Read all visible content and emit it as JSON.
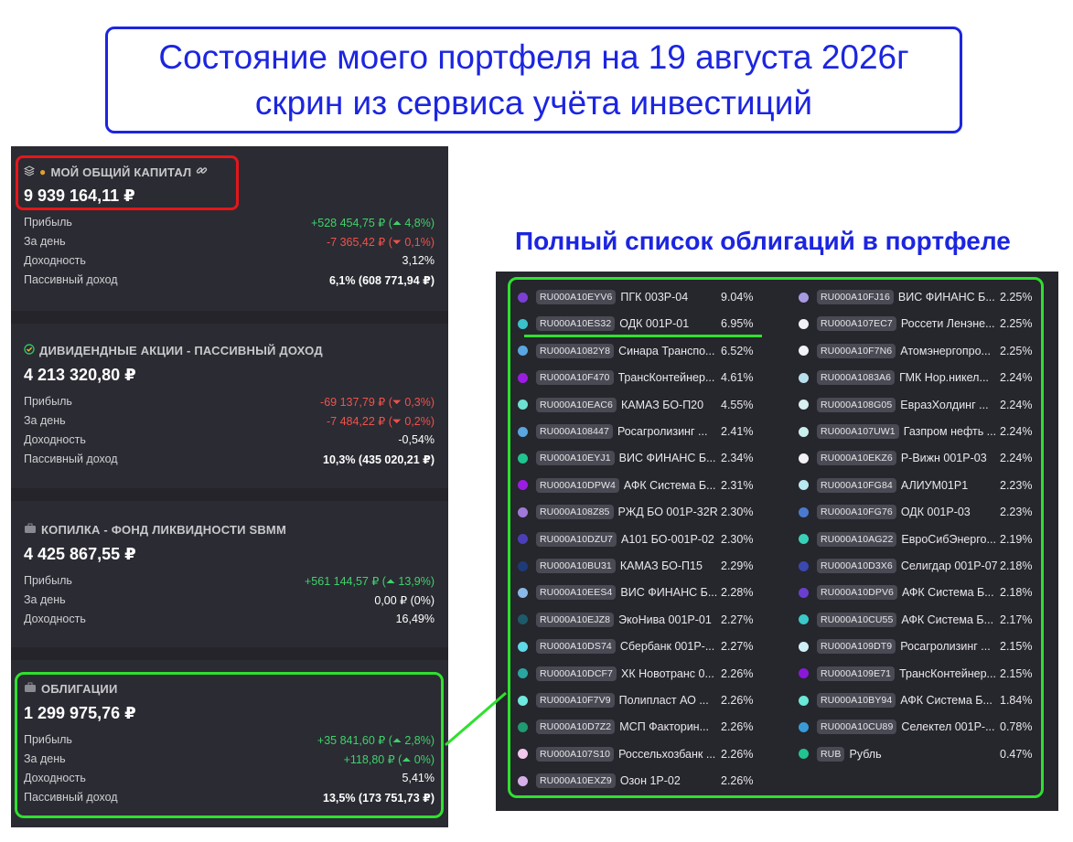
{
  "title": {
    "line1": "Состояние моего портфеля на 19 августа 2026г",
    "line2": "скрин из сервиса учёта инвестиций"
  },
  "bonds_heading": "Полный список облигаций в портфеле",
  "colors": {
    "positive": "#3fd26a",
    "negative": "#f0524c",
    "highlight_red": "#e5161a",
    "highlight_green": "#2fe02f",
    "title_blue": "#1c25e0"
  },
  "cards": [
    {
      "icons": [
        "layers-icon",
        "money-bag-icon",
        "link-icon"
      ],
      "title": "МОЙ ОБЩИЙ КАПИТАЛ",
      "value": "9 939 164,11 ₽",
      "rows": [
        {
          "label": "Прибыль",
          "value": "+528 454,75 ₽ (⏶ 4,8%)",
          "tone": "pos"
        },
        {
          "label": "За день",
          "value": "-7 365,42 ₽ (⏷ 0,1%)",
          "tone": "neg"
        },
        {
          "label": "Доходность",
          "value": "3,12%",
          "tone": "wh"
        },
        {
          "label": "Пассивный доход",
          "value": "6,1% (608 771,94 ₽)",
          "tone": "wh bold"
        }
      ]
    },
    {
      "icons": [
        "check-circle-icon"
      ],
      "title": "ДИВИДЕНДНЫЕ АКЦИИ - ПАССИВНЫЙ ДОХОД",
      "value": "4 213 320,80 ₽",
      "rows": [
        {
          "label": "Прибыль",
          "value": "-69 137,79 ₽ (⏷ 0,3%)",
          "tone": "neg"
        },
        {
          "label": "За день",
          "value": "-7 484,22 ₽ (⏷ 0,2%)",
          "tone": "neg"
        },
        {
          "label": "Доходность",
          "value": "-0,54%",
          "tone": "wh"
        },
        {
          "label": "Пассивный доход",
          "value": "10,3% (435 020,21 ₽)",
          "tone": "wh bold"
        }
      ]
    },
    {
      "icons": [
        "briefcase-icon"
      ],
      "title": "КОПИЛКА - ФОНД ЛИКВИДНОСТИ SBMM",
      "value": "4 425 867,55 ₽",
      "rows": [
        {
          "label": "Прибыль",
          "value": "+561 144,57 ₽ (⏶ 13,9%)",
          "tone": "pos"
        },
        {
          "label": "За день",
          "value": "0,00 ₽ (0%)",
          "tone": "wh",
          "suffix_pos": true
        },
        {
          "label": "Доходность",
          "value": "16,49%",
          "tone": "wh"
        }
      ]
    },
    {
      "icons": [
        "briefcase-icon"
      ],
      "title": "ОБЛИГАЦИИ",
      "value": "1 299 975,76 ₽",
      "rows": [
        {
          "label": "Прибыль",
          "value": "+35 841,60 ₽ (⏶ 2,8%)",
          "tone": "pos"
        },
        {
          "label": "За день",
          "value": "+118,80 ₽ (⏶ 0%)",
          "tone": "pos"
        },
        {
          "label": "Доходность",
          "value": "5,41%",
          "tone": "wh"
        },
        {
          "label": "Пассивный доход",
          "value": "13,5% (173 751,73 ₽)",
          "tone": "wh bold"
        }
      ]
    }
  ],
  "bonds_left": [
    {
      "color": "#7b3fd4",
      "isin": "RU000A10EYV6",
      "name": "ПГК 003Р-04",
      "pct": "9.04%"
    },
    {
      "color": "#3ac1c9",
      "isin": "RU000A10ES32",
      "name": "ОДК 001Р-01",
      "pct": "6.95%"
    },
    {
      "color": "#5aa6e0",
      "isin": "RU000A1082Y8",
      "name": "Синара Транспо...",
      "pct": "6.52%"
    },
    {
      "color": "#9a1de0",
      "isin": "RU000A10F470",
      "name": "ТрансКонтейнер...",
      "pct": "4.61%"
    },
    {
      "color": "#6fe0d0",
      "isin": "RU000A10EAC6",
      "name": "КАМАЗ БО-П20",
      "pct": "4.55%"
    },
    {
      "color": "#5aa6e0",
      "isin": "RU000A108447",
      "name": "Росагролизинг ...",
      "pct": "2.41%"
    },
    {
      "color": "#21c38e",
      "isin": "RU000A10EYJ1",
      "name": "ВИС ФИНАНС Б...",
      "pct": "2.34%"
    },
    {
      "color": "#9a1de0",
      "isin": "RU000A10DPW4",
      "name": "АФК Система Б...",
      "pct": "2.31%"
    },
    {
      "color": "#a07ad8",
      "isin": "RU000A108Z85",
      "name": "РЖД БО 001Р-32R",
      "pct": "2.30%"
    },
    {
      "color": "#4b3fb8",
      "isin": "RU000A10DZU7",
      "name": "А101 БО-001Р-02",
      "pct": "2.30%"
    },
    {
      "color": "#1f3a78",
      "isin": "RU000A10BU31",
      "name": "КАМАЗ БО-П15",
      "pct": "2.29%"
    },
    {
      "color": "#8ab8e8",
      "isin": "RU000A10EES4",
      "name": "ВИС ФИНАНС Б...",
      "pct": "2.28%"
    },
    {
      "color": "#1d5a6a",
      "isin": "RU000A10EJZ8",
      "name": "ЭкоНива 001Р-01",
      "pct": "2.27%"
    },
    {
      "color": "#5fd8e8",
      "isin": "RU000A10DS74",
      "name": "Сбербанк 001Р-...",
      "pct": "2.27%"
    },
    {
      "color": "#2aa6a0",
      "isin": "RU000A10DCF7",
      "name": "ХК Новотранс 0...",
      "pct": "2.26%"
    },
    {
      "color": "#6fe8e0",
      "isin": "RU000A10F7V9",
      "name": "Полипласт АО ...",
      "pct": "2.26%"
    },
    {
      "color": "#1f9a72",
      "isin": "RU000A10D7Z2",
      "name": "МСП Факторин...",
      "pct": "2.26%"
    },
    {
      "color": "#f2c8ec",
      "isin": "RU000A107S10",
      "name": "Россельхозбанк ...",
      "pct": "2.26%"
    },
    {
      "color": "#d8b0e8",
      "isin": "RU000A10EXZ9",
      "name": "Озон 1Р-02",
      "pct": "2.26%"
    }
  ],
  "bonds_right": [
    {
      "color": "#a89ae0",
      "isin": "RU000A10FJ16",
      "name": "ВИС ФИНАНС Б...",
      "pct": "2.25%"
    },
    {
      "color": "#f2f2f6",
      "isin": "RU000A107EC7",
      "name": "Россети Ленэне...",
      "pct": "2.25%"
    },
    {
      "color": "#f2f2f6",
      "isin": "RU000A10F7N6",
      "name": "Атомэнергопро...",
      "pct": "2.25%"
    },
    {
      "color": "#b8e0ec",
      "isin": "RU000A1083A6",
      "name": "ГМК Нор.никел...",
      "pct": "2.24%"
    },
    {
      "color": "#d8f0f0",
      "isin": "RU000A108G05",
      "name": "ЕвразХолдинг ...",
      "pct": "2.24%"
    },
    {
      "color": "#c8f0ec",
      "isin": "RU000A107UW1",
      "name": "Газпром нефть ...",
      "pct": "2.24%"
    },
    {
      "color": "#f2f2f6",
      "isin": "RU000A10EKZ6",
      "name": "Р-Вижн 001Р-03",
      "pct": "2.24%"
    },
    {
      "color": "#b8e8f0",
      "isin": "RU000A10FG84",
      "name": "АЛИУМ01Р1",
      "pct": "2.23%"
    },
    {
      "color": "#4a7ad0",
      "isin": "RU000A10FG76",
      "name": "ОДК 001Р-03",
      "pct": "2.23%"
    },
    {
      "color": "#3ad0b8",
      "isin": "RU000A10AG22",
      "name": "ЕвроСибЭнерго...",
      "pct": "2.19%"
    },
    {
      "color": "#3a48b0",
      "isin": "RU000A10D3X6",
      "name": "Селигдар 001Р-07",
      "pct": "2.18%"
    },
    {
      "color": "#6a3fd0",
      "isin": "RU000A10DPV6",
      "name": "АФК Система Б...",
      "pct": "2.18%"
    },
    {
      "color": "#3ac8c8",
      "isin": "RU000A10CU55",
      "name": "АФК Система Б...",
      "pct": "2.17%"
    },
    {
      "color": "#d0f0f8",
      "isin": "RU000A109DT9",
      "name": "Росагролизинг ...",
      "pct": "2.15%"
    },
    {
      "color": "#8a18d8",
      "isin": "RU000A109E71",
      "name": "ТрансКонтейнер...",
      "pct": "2.15%"
    },
    {
      "color": "#6ae8d8",
      "isin": "RU000A10BY94",
      "name": "АФК Система Б...",
      "pct": "1.84%"
    },
    {
      "color": "#3a9ad8",
      "isin": "RU000A10CU89",
      "name": "Селектел 001Р-...",
      "pct": "0.78%"
    },
    {
      "color": "#21c38e",
      "isin": "RUB",
      "name": "Рубль",
      "pct": "0.47%"
    }
  ]
}
